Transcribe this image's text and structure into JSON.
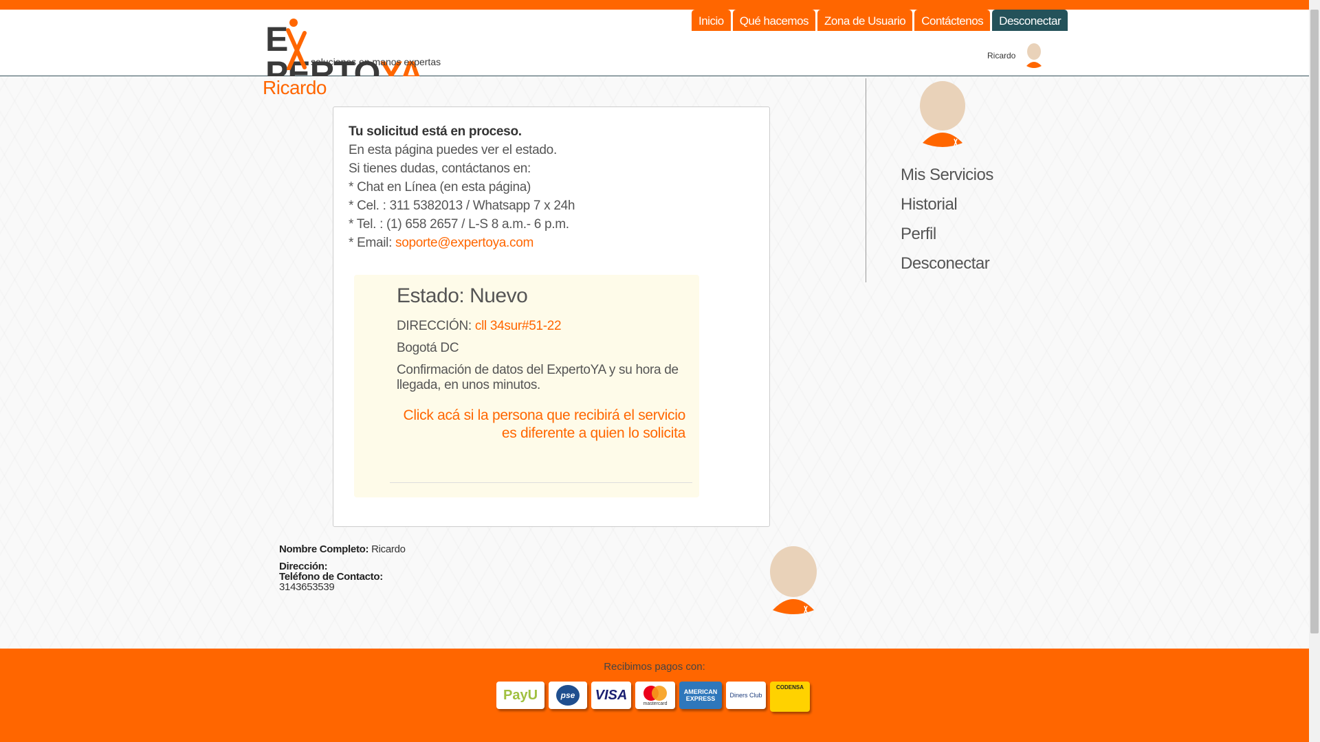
{
  "brand": {
    "logo_text_a": "E",
    "logo_text_b": "PERTO",
    "logo_text_c": "YA",
    "tagline": "soluciones en manos expertas"
  },
  "nav": {
    "items": [
      "Inicio",
      "Qué hacemos",
      "Zona de Usuario",
      "Contáctenos",
      "Desconectar"
    ]
  },
  "user": {
    "name": "Ricardo"
  },
  "page": {
    "title": "Ricardo"
  },
  "card": {
    "heading": "Tu solicitud está en proceso.",
    "line1": "En esta página puedes ver el estado.",
    "line2": "Si tienes dudas, contáctanos en:",
    "line3": "* Chat en Línea (en esta página)",
    "line4": "* Cel. : 311 5382013 / Whatsapp 7 x 24h",
    "line5": "* Tel. : (1) 658 2657 / L-S 8 a.m.- 6 p.m.",
    "email_label": "* Email: ",
    "email": "soporte@expertoya.com"
  },
  "status": {
    "title": "Estado: Nuevo",
    "address_label": "DIRECCIÓN: ",
    "address": "cll 34sur#51-22",
    "city": "Bogotá DC",
    "confirm": "Confirmación de datos del ExpertoYA y su hora de llegada, en unos minutos.",
    "link": "Click acá si la persona que recibirá el servicio es diferente a quien lo solicita"
  },
  "sidebar": {
    "items": [
      "Mis Servicios",
      "Historial",
      "Perfil",
      "Desconectar"
    ]
  },
  "info": {
    "name_label": "Nombre Completo:",
    "name_value": "Ricardo",
    "address_label": "Dirección:",
    "phone_label": "Teléfono de Contacto:",
    "phone_value": "3143653539"
  },
  "footer": {
    "label": "Recibimos pagos con:",
    "methods": [
      "PayU",
      "pse",
      "VISA",
      "mastercard",
      "AMERICAN EXPRESS",
      "Diners Club",
      "CODENSA"
    ]
  },
  "colors": {
    "accent": "#ff6600",
    "dark_tab": "#24525a"
  }
}
